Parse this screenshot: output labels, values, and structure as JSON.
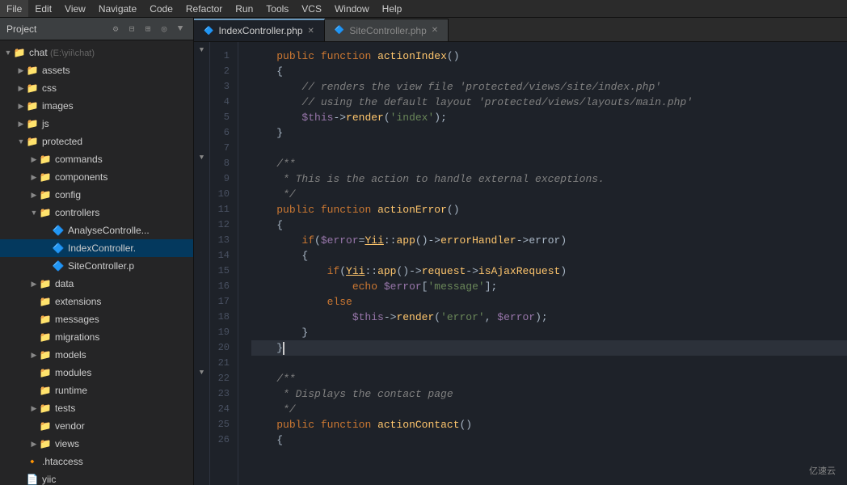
{
  "menubar": {
    "items": [
      "File",
      "Edit",
      "View",
      "Navigate",
      "Code",
      "Refactor",
      "Run",
      "Tools",
      "VCS",
      "Window",
      "Help"
    ]
  },
  "sidebar": {
    "project_label": "Project",
    "root": {
      "name": "chat",
      "path": "E:\\yii\\chat",
      "children": [
        {
          "name": "assets",
          "type": "folder",
          "indent": 1
        },
        {
          "name": "css",
          "type": "folder",
          "indent": 1
        },
        {
          "name": "images",
          "type": "folder",
          "indent": 1
        },
        {
          "name": "js",
          "type": "folder",
          "indent": 1
        },
        {
          "name": "protected",
          "type": "folder",
          "indent": 1,
          "expanded": true,
          "children": [
            {
              "name": "commands",
              "type": "folder",
              "indent": 2
            },
            {
              "name": "components",
              "type": "folder",
              "indent": 2
            },
            {
              "name": "config",
              "type": "folder",
              "indent": 2
            },
            {
              "name": "controllers",
              "type": "folder",
              "indent": 2,
              "expanded": true,
              "children": [
                {
                  "name": "AnalyseControlle...",
                  "type": "php",
                  "indent": 3
                },
                {
                  "name": "IndexController.",
                  "type": "php",
                  "indent": 3,
                  "selected": true
                },
                {
                  "name": "SiteController.p",
                  "type": "php",
                  "indent": 3
                }
              ]
            },
            {
              "name": "data",
              "type": "folder",
              "indent": 2
            },
            {
              "name": "extensions",
              "type": "folder",
              "indent": 2
            },
            {
              "name": "messages",
              "type": "folder",
              "indent": 2
            },
            {
              "name": "migrations",
              "type": "folder",
              "indent": 2
            },
            {
              "name": "models",
              "type": "folder",
              "indent": 2
            },
            {
              "name": "modules",
              "type": "folder",
              "indent": 2
            },
            {
              "name": "runtime",
              "type": "folder",
              "indent": 2
            },
            {
              "name": "tests",
              "type": "folder",
              "indent": 2
            },
            {
              "name": "vendor",
              "type": "folder",
              "indent": 2
            },
            {
              "name": "views",
              "type": "folder",
              "indent": 2
            }
          ]
        },
        {
          "name": ".htaccess",
          "type": "file",
          "indent": 1
        },
        {
          "name": "yiic",
          "type": "file",
          "indent": 1
        }
      ]
    }
  },
  "tabs": [
    {
      "label": "IndexController.php",
      "active": true,
      "icon": "php"
    },
    {
      "label": "SiteController.php",
      "active": false,
      "icon": "php"
    }
  ],
  "code_lines": [
    {
      "num": 1,
      "content": "    public function actionIndex()",
      "fold": true
    },
    {
      "num": 2,
      "content": "    {"
    },
    {
      "num": 3,
      "content": "        // renders the view file 'protected/views/site/index.php'",
      "type": "comment"
    },
    {
      "num": 4,
      "content": "        // using the default layout 'protected/views/layouts/main.php'",
      "type": "comment"
    },
    {
      "num": 5,
      "content": "        $this->render('index');"
    },
    {
      "num": 6,
      "content": "    }"
    },
    {
      "num": 7,
      "content": ""
    },
    {
      "num": 8,
      "content": "    /**",
      "type": "comment",
      "fold": true
    },
    {
      "num": 9,
      "content": "     * This is the action to handle external exceptions.",
      "type": "comment"
    },
    {
      "num": 10,
      "content": "     */",
      "type": "comment"
    },
    {
      "num": 11,
      "content": "    public function actionError()"
    },
    {
      "num": 12,
      "content": "    {"
    },
    {
      "num": 13,
      "content": "        if($error=Yii::app()->errorHandler->error)"
    },
    {
      "num": 14,
      "content": "        {"
    },
    {
      "num": 15,
      "content": "            if(Yii::app()->request->isAjaxRequest)"
    },
    {
      "num": 16,
      "content": "                echo $error['message'];"
    },
    {
      "num": 17,
      "content": "            else"
    },
    {
      "num": 18,
      "content": "                $this->render('error', $error);"
    },
    {
      "num": 19,
      "content": "        }"
    },
    {
      "num": 20,
      "content": "    }",
      "current": true
    },
    {
      "num": 21,
      "content": ""
    },
    {
      "num": 22,
      "content": "    /**",
      "type": "comment",
      "fold": true
    },
    {
      "num": 23,
      "content": "     * Displays the contact page",
      "type": "comment"
    },
    {
      "num": 24,
      "content": "     */",
      "type": "comment"
    },
    {
      "num": 25,
      "content": "    public function actionContact()"
    },
    {
      "num": 26,
      "content": "    {"
    }
  ],
  "watermark": "亿速云"
}
